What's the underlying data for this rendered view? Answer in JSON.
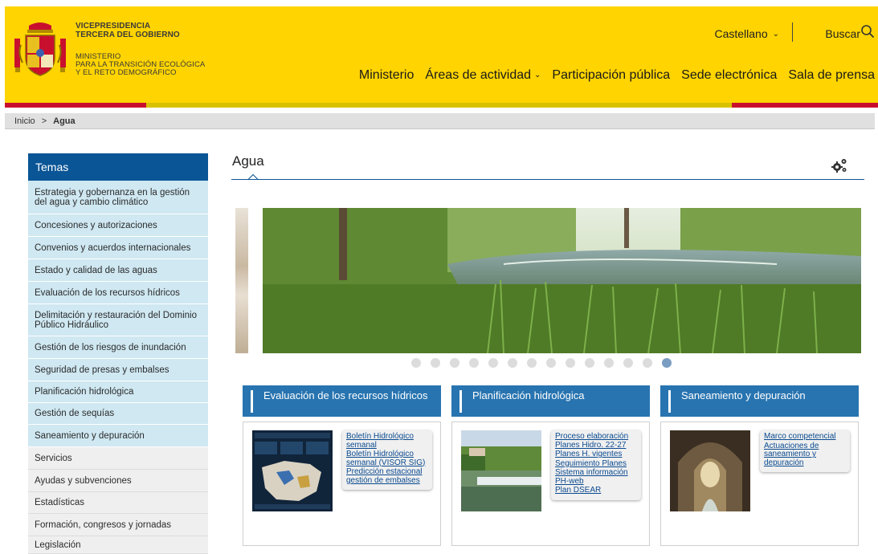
{
  "header": {
    "gov_lines": [
      "VICEPRESIDENCIA",
      "TERCERA DEL GOBIERNO",
      "MINISTERIO",
      "PARA LA TRANSICIÓN ECOLÓGICA",
      "Y EL RETO DEMOGRÁFICO"
    ],
    "language": "Castellano",
    "search_label": "Buscar",
    "nav": [
      {
        "label": "Ministerio"
      },
      {
        "label": "Áreas de actividad"
      },
      {
        "label": "Participación pública"
      },
      {
        "label": "Sede electrónica"
      },
      {
        "label": "Sala de prensa"
      }
    ],
    "colors": {
      "yellow": "#ffd400",
      "red": "#c8102e"
    }
  },
  "breadcrumb": {
    "home": "Inicio",
    "separator": ">",
    "current": "Agua"
  },
  "sidebar": {
    "title": "Temas",
    "topics": [
      "Estrategia y gobernanza en la gestión del agua y cambio climático",
      "Concesiones y autorizaciones",
      "Convenios y acuerdos internacionales",
      "Estado y calidad de las aguas",
      "Evaluación de los recursos hídricos",
      "Delimitación y restauración del Dominio Público Hidráulico",
      "Gestión de los riesgos de inundación",
      "Seguridad de presas y embalses",
      "Planificación hidrológica",
      "Gestión de sequías",
      "Saneamiento y depuración"
    ],
    "others": [
      "Servicios",
      "Ayudas y subvenciones",
      "Estadísticas",
      "Formación, congresos y jornadas",
      "Legislación"
    ]
  },
  "main": {
    "title": "Agua",
    "carousel": {
      "slide_count": 14,
      "active_index": 13
    },
    "cards": [
      {
        "title": "Evaluación de los recursos hídricos",
        "links": [
          "Boletín Hidrológico semanal",
          "Boletín Hidrológico semanal (VISOR SIG)",
          "Predicción estacional gestión de embalses"
        ]
      },
      {
        "title": "Planificación hidrológica",
        "links": [
          "Proceso elaboración Planes Hidro. 22-27",
          "Planes H. vigentes",
          "Seguimiento Planes",
          "Sistema información PH-web",
          "Plan DSEAR"
        ]
      },
      {
        "title": "Saneamiento y depuración",
        "links": [
          "Marco competencial",
          "Actuaciones de saneamiento y depuración"
        ]
      }
    ]
  }
}
